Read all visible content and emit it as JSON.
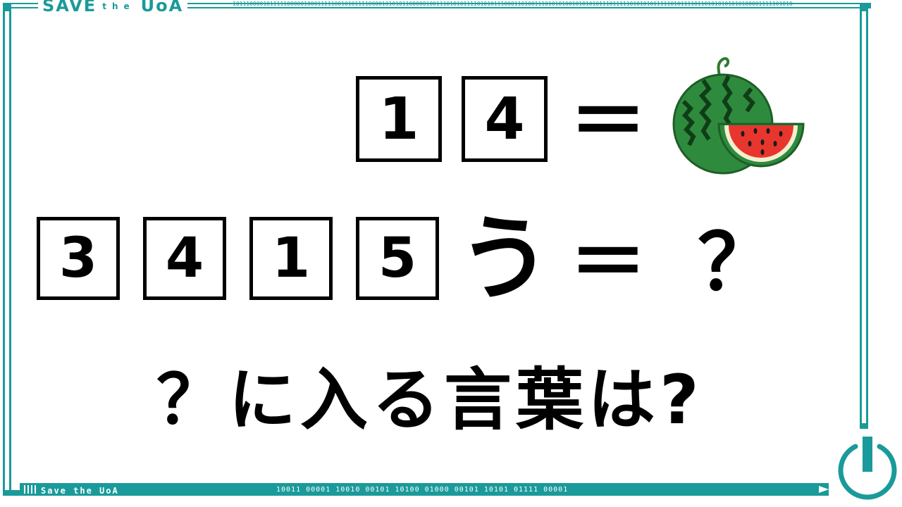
{
  "brand": {
    "top_title_a": "SAVE",
    "top_title_b": "the",
    "top_title_c": "UoA",
    "bottom_label": "Save  the  UoA"
  },
  "decor": {
    "binary_bottom": "10011  00001  10010  00101  10100  01000  00101  10101  01111  00001",
    "binary_top": "101110000101111100000100011111001010111100001010101100000100111010101111010101110001101001110101010010101010111011111010101011111010111101101010101010100001111101010"
  },
  "puzzle": {
    "row1": {
      "box1": "1",
      "box2": "4",
      "equals": "＝"
    },
    "row2": {
      "box1": "3",
      "box2": "4",
      "box3": "1",
      "box4": "5",
      "kana": "う",
      "equals": "＝",
      "question": "？"
    },
    "question_text": "？に入る言葉は?"
  },
  "colors": {
    "frame": "#1a9a9a",
    "text": "#000000",
    "melon_green": "#2e8b3d",
    "melon_flesh": "#e8362e"
  },
  "icons": [
    "watermelon-icon",
    "power-icon"
  ]
}
